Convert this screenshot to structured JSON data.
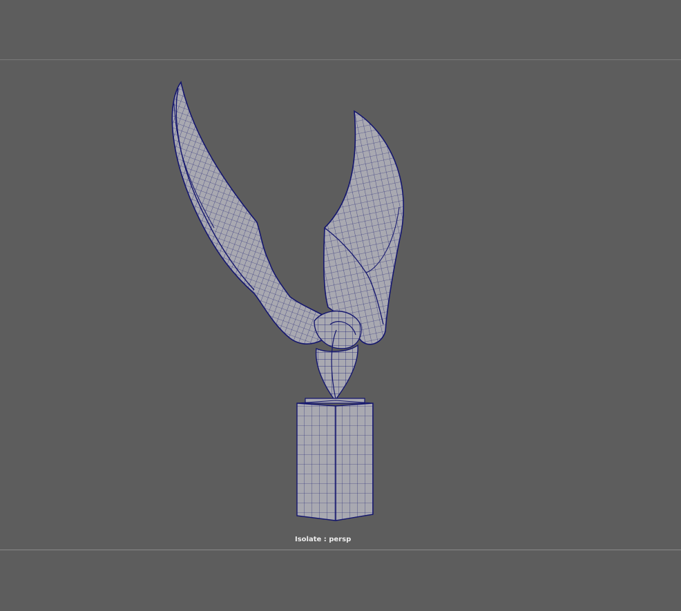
{
  "viewport": {
    "camera_label": "Isolate : persp",
    "background_color": "#5d5d5d",
    "wireframe_color": "#14166e",
    "surface_color": "#a9a9b1"
  },
  "model": {
    "object": "sculpture-wings-on-pedestal",
    "display_mode": "wireframe-on-shaded"
  }
}
